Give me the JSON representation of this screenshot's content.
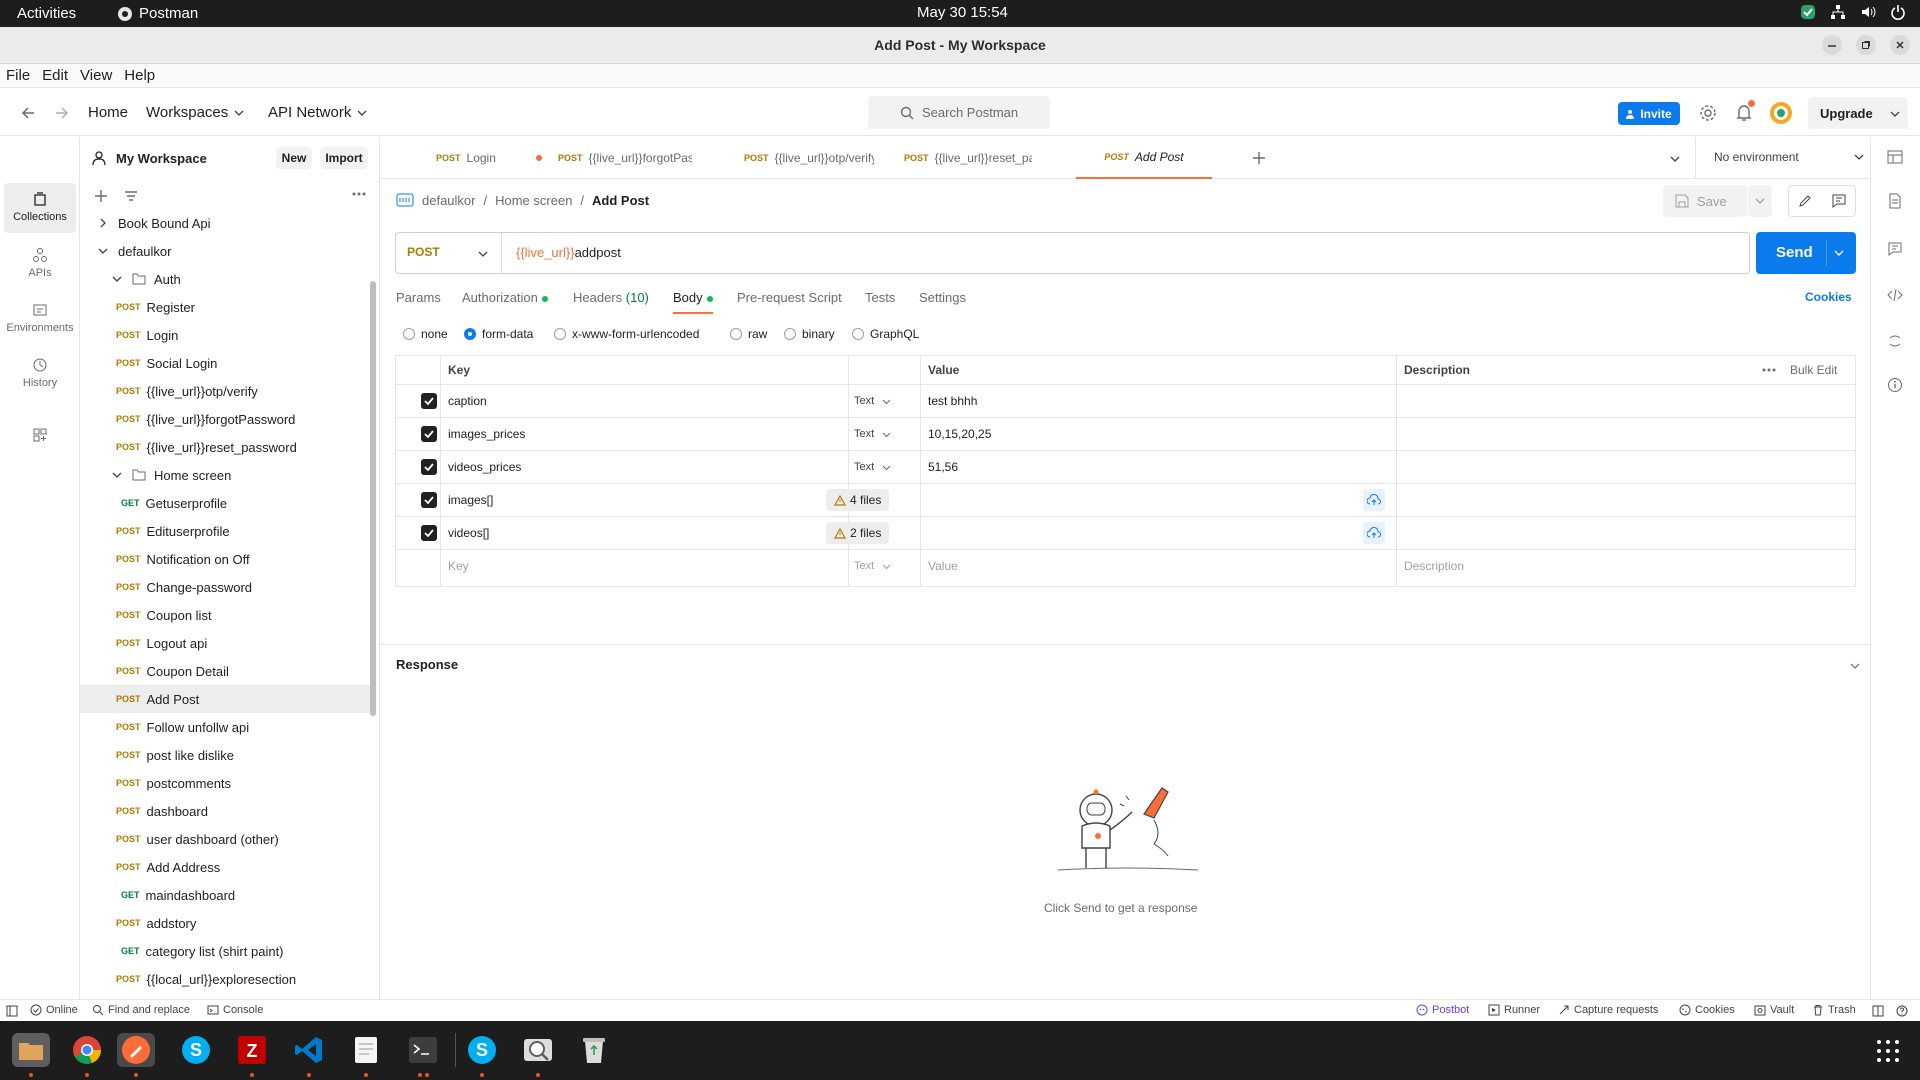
{
  "system": {
    "activities": "Activities",
    "app_name": "Postman",
    "clock": "May 30  15:54"
  },
  "window": {
    "title": "Add Post - My Workspace"
  },
  "menu": [
    "File",
    "Edit",
    "View",
    "Help"
  ],
  "header": {
    "home": "Home",
    "workspaces": "Workspaces",
    "api_network": "API Network",
    "search_placeholder": "Search Postman",
    "invite": "Invite",
    "upgrade": "Upgrade"
  },
  "rail": {
    "collections": "Collections",
    "apis": "APIs",
    "environments": "Environments",
    "history": "History"
  },
  "sidebar": {
    "workspace": "My Workspace",
    "new": "New",
    "import": "Import",
    "items": [
      {
        "method": "",
        "label": "Book Bound Api",
        "kind": "collection"
      },
      {
        "method": "",
        "label": "defaulkor",
        "kind": "collection-open"
      },
      {
        "method": "",
        "label": "Auth",
        "kind": "folder"
      },
      {
        "method": "POST",
        "label": "Register"
      },
      {
        "method": "POST",
        "label": "Login"
      },
      {
        "method": "POST",
        "label": "Social Login"
      },
      {
        "method": "POST",
        "label": "{{live_url}}otp/verify"
      },
      {
        "method": "POST",
        "label": "{{live_url}}forgotPassword"
      },
      {
        "method": "POST",
        "label": "{{live_url}}reset_password"
      },
      {
        "method": "",
        "label": "Home screen",
        "kind": "folder"
      },
      {
        "method": "GET",
        "label": "Getuserprofile"
      },
      {
        "method": "POST",
        "label": "Edituserprofile"
      },
      {
        "method": "POST",
        "label": "Notification on Off"
      },
      {
        "method": "POST",
        "label": "Change-password"
      },
      {
        "method": "POST",
        "label": "Coupon list"
      },
      {
        "method": "POST",
        "label": "Logout api"
      },
      {
        "method": "POST",
        "label": "Coupon Detail"
      },
      {
        "method": "POST",
        "label": "Add Post"
      },
      {
        "method": "POST",
        "label": "Follow unfollw api"
      },
      {
        "method": "POST",
        "label": "post like dislike"
      },
      {
        "method": "POST",
        "label": "postcomments"
      },
      {
        "method": "POST",
        "label": "dashboard"
      },
      {
        "method": "POST",
        "label": "user dashboard (other)"
      },
      {
        "method": "POST",
        "label": "Add Address"
      },
      {
        "method": "GET",
        "label": "maindashboard"
      },
      {
        "method": "POST",
        "label": "addstory"
      },
      {
        "method": "GET",
        "label": "category list (shirt paint)"
      },
      {
        "method": "POST",
        "label": "{{local_url}}exploresection"
      }
    ]
  },
  "tabs": [
    {
      "method": "POST",
      "label": "Login"
    },
    {
      "method": "POST",
      "label": "{{live_url}}forgotPassw"
    },
    {
      "method": "POST",
      "label": "{{live_url}}otp/verify"
    },
    {
      "method": "POST",
      "label": "{{live_url}}reset_passw"
    },
    {
      "method": "POST",
      "label": "Add Post"
    }
  ],
  "environment": "No environment",
  "breadcrumb": {
    "collection": "defaulkor",
    "folder": "Home screen",
    "request": "Add Post"
  },
  "save": "Save",
  "request": {
    "method": "POST",
    "url_var": "{{live_url}}",
    "url_path": "addpost",
    "send": "Send"
  },
  "subtabs": {
    "params": "Params",
    "authorization": "Authorization",
    "headers": "Headers",
    "headers_count": "(10)",
    "body": "Body",
    "pre_request": "Pre-request Script",
    "tests": "Tests",
    "settings": "Settings",
    "cookies": "Cookies"
  },
  "body_modes": [
    "none",
    "form-data",
    "x-www-form-urlencoded",
    "raw",
    "binary",
    "GraphQL"
  ],
  "body_mode_selected": "form-data",
  "form_table": {
    "headers": {
      "key": "Key",
      "value": "Value",
      "description": "Description",
      "bulk_edit": "Bulk Edit"
    },
    "rows": [
      {
        "key": "caption",
        "type": "Text",
        "value": "test bhhh"
      },
      {
        "key": "images_prices",
        "type": "Text",
        "value": "10,15,20,25"
      },
      {
        "key": "videos_prices",
        "type": "Text",
        "value": "51,56"
      },
      {
        "key": "images[]",
        "type": "File",
        "value": "4 files"
      },
      {
        "key": "videos[]",
        "type": "File",
        "value": "2 files"
      }
    ],
    "placeholder": {
      "key": "Key",
      "type": "Text",
      "value": "Value",
      "description": "Description"
    }
  },
  "response": {
    "title": "Response",
    "empty": "Click Send to get a response"
  },
  "footer": {
    "online": "Online",
    "find_replace": "Find and replace",
    "console": "Console",
    "postbot": "Postbot",
    "runner": "Runner",
    "capture": "Capture requests",
    "cookies": "Cookies",
    "vault": "Vault",
    "trash": "Trash"
  },
  "colors": {
    "accent": "#097bed",
    "postman_orange": "#ff6c37",
    "post_method": "#ad7a03",
    "get_method": "#007f31"
  }
}
